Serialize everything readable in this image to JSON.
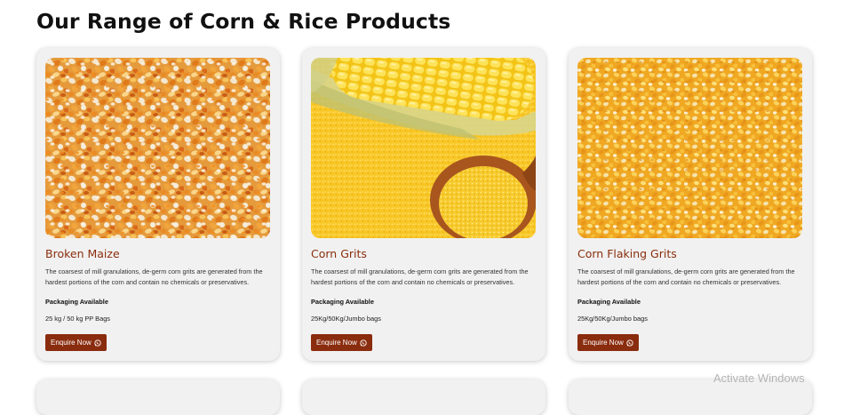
{
  "page": {
    "title": "Our Range of Corn & Rice Products"
  },
  "products": [
    {
      "title": "Broken Maize",
      "description": "The coarsest of mill granulations, de-germ corn grits are generated from the hardest portions of the corn and contain no chemicals or preservatives.",
      "packaging_label": "Packaging Available",
      "packaging_value": "25 kg / 50 kg PP Bags",
      "button_label": "Enquire Now",
      "image": "broken-maize-kernels"
    },
    {
      "title": "Corn Grits",
      "description": "The coarsest of mill granulations, de-germ corn grits are generated from the hardest portions of the corn and contain no chemicals or preservatives.",
      "packaging_label": "Packaging Available",
      "packaging_value": "25Kg/50Kg/Jumbo bags",
      "button_label": "Enquire Now",
      "image": "corn-cob-and-grits-in-wooden-spoon"
    },
    {
      "title": "Corn Flaking Grits",
      "description": "The coarsest of mill granulations, de-germ corn grits are generated from the hardest portions of the corn and contain no chemicals or preservatives.",
      "packaging_label": "Packaging Available",
      "packaging_value": "25Kg/50Kg/Jumbo bags",
      "button_label": "Enquire Now",
      "image": "corn-flaking-grits-kernels"
    }
  ],
  "icons": {
    "button_icon": "whatsapp-icon"
  },
  "colors": {
    "brand": "#8a2c0e",
    "title": "#8a2e0c",
    "card_bg": "#f1f1f1"
  },
  "os_watermark": "Activate Windows"
}
